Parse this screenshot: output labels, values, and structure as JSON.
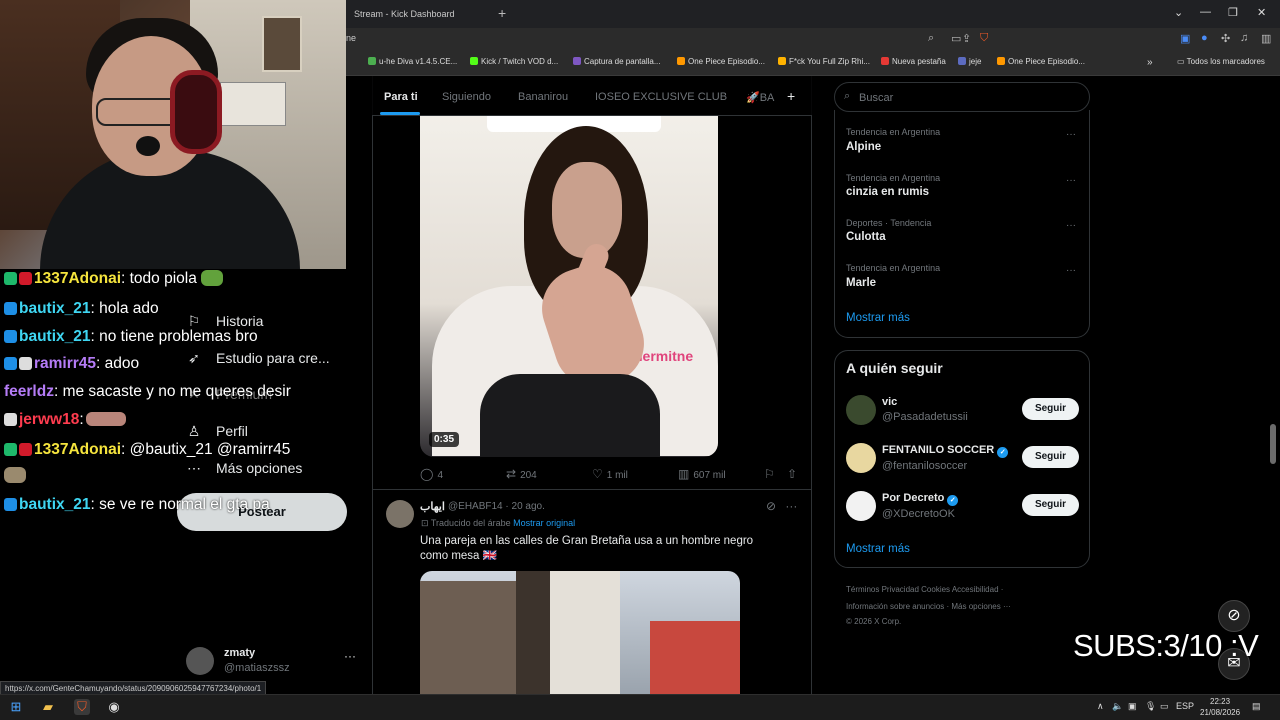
{
  "browser": {
    "tab_title": "Stream - Kick Dashboard",
    "address_fragment": "ne",
    "bookmarks": [
      {
        "label": "u-he Diva v1.4.5.CE...",
        "color": "#4caf50"
      },
      {
        "label": "Kick / Twitch VOD d...",
        "color": "#53fc18"
      },
      {
        "label": "Captura de pantalla...",
        "color": "#7e57c2"
      },
      {
        "label": "One Piece Episodio...",
        "color": "#ff9800"
      },
      {
        "label": "F*ck You Full Zip Rhi...",
        "color": "#ffb300"
      },
      {
        "label": "Nueva pestaña",
        "color": "#e53935"
      },
      {
        "label": "jeje",
        "color": "#5c6bc0"
      },
      {
        "label": "One Piece Episodio...",
        "color": "#ff9800"
      }
    ],
    "all_bookmarks": "Todos los marcadores",
    "status_url": "https://x.com/GenteChamuyando/status/2090906025947767234/photo/1"
  },
  "chat": [
    {
      "name": "1337Adonai",
      "text": ": todo piola",
      "color_class": "name-yellow"
    },
    {
      "name": "bautix_21",
      "text": ": hola ado",
      "color_class": "name-cyan"
    },
    {
      "name": "bautix_21",
      "text": ": no tiene problemas bro",
      "color_class": "name-cyan"
    },
    {
      "name": "ramirr45",
      "text": ": adoo",
      "color_class": "name-purple"
    },
    {
      "name": "feerldz",
      "text": ": me sacaste y no me queres desir",
      "color_class": "name-purple"
    },
    {
      "name": "jerww18",
      "text": ":",
      "color_class": "name-red"
    },
    {
      "name": "1337Adonai",
      "text": ": @bautix_21 @ramirr45",
      "color_class": "name-yellow"
    },
    {
      "name": "bautix_21",
      "text": ": se ve re normal el gta pa",
      "color_class": "name-cyan"
    }
  ],
  "nav": {
    "historia": "Historia",
    "estudio": "Estudio para cre...",
    "premium": "Premium",
    "perfil": "Perfil",
    "mas_opciones": "Más opciones",
    "postear": "Postear"
  },
  "account": {
    "name": "zmaty",
    "handle": "@matiaszssz"
  },
  "feed_tabs": [
    "Para ti",
    "Siguiendo",
    "Bananirou",
    "IOSEO EXCLUSIVE CLUB",
    "BA"
  ],
  "post1": {
    "duration": "0:35",
    "replies": "4",
    "reposts": "204",
    "likes": "1 mil",
    "views": "607 mil"
  },
  "post2": {
    "name": "ايهاب",
    "meta": "@EHABF14 · 20 ago.",
    "translated": "Traducido del árabe",
    "show_original": "Mostrar original",
    "text": "Una pareja en las calles de Gran Bretaña usa a un hombre negro como mesa 🇬🇧"
  },
  "sidebar": {
    "search_placeholder": "Buscar",
    "trends": [
      {
        "meta": "Tendencia en Argentina",
        "name": "Alpine"
      },
      {
        "meta": "Tendencia en Argentina",
        "name": "cinzia en rumis"
      },
      {
        "meta": "Deportes · Tendencia",
        "name": "Culotta"
      },
      {
        "meta": "Tendencia en Argentina",
        "name": "Marle"
      }
    ],
    "show_more": "Mostrar más",
    "who_to_follow": "A quién seguir",
    "follow_suggestions": [
      {
        "name": "vic",
        "handle": "@Pasadadetussii",
        "verified": false,
        "avatar_color": "#3a4a2e",
        "button": "Seguir"
      },
      {
        "name": "FENTANILO SOCCER",
        "handle": "@fentanilosoccer",
        "verified": true,
        "avatar_color": "#e8d7a0",
        "button": "Seguir"
      },
      {
        "name": "Por Decreto",
        "handle": "@XDecretoOK",
        "verified": true,
        "avatar_color": "#f2f2f2",
        "button": "Seguir"
      }
    ],
    "show_more_2": "Mostrar más",
    "footer_line1": "Términos    Privacidad    Cookies    Accesibilidad  ·",
    "footer_line2": "Información sobre anuncios  ·  Más opciones ···",
    "footer_line3": "© 2026 X Corp."
  },
  "overlay": {
    "subs": "SUBS:3/10 :V"
  },
  "taskbar": {
    "lang": "ESP",
    "time": "22:23",
    "date": "21/08/2026"
  }
}
